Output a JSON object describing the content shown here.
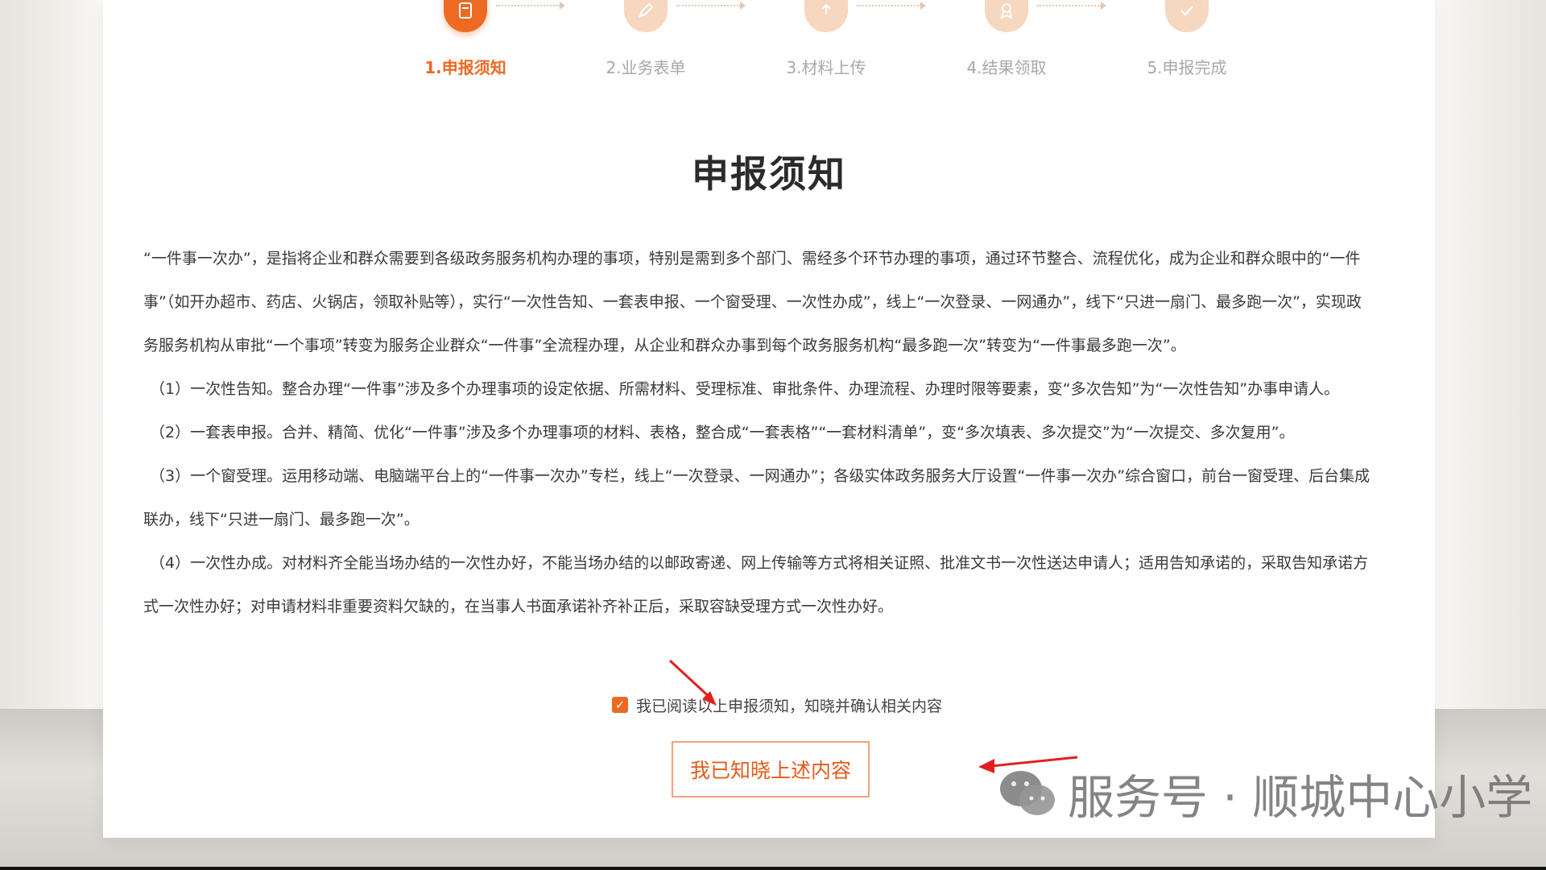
{
  "steps": [
    {
      "label": "1.申报须知",
      "icon": "document-icon",
      "active": true
    },
    {
      "label": "2.业务表单",
      "icon": "form-edit-icon",
      "active": false
    },
    {
      "label": "3.材料上传",
      "icon": "upload-icon",
      "active": false
    },
    {
      "label": "4.结果领取",
      "icon": "award-icon",
      "active": false
    },
    {
      "label": "5.申报完成",
      "icon": "check-icon",
      "active": false
    }
  ],
  "title": "申报须知",
  "paragraphs": [
    "“一件事一次办”，是指将企业和群众需要到各级政务服务机构办理的事项，特别是需到多个部门、需经多个环节办理的事项，通过环节整合、流程优化，成为企业和群众眼中的“一件事”（如开办超市、药店、火锅店，领取补贴等），实行“一次性告知、一套表申报、一个窗受理、一次性办成”，线上“一次登录、一网通办”，线下“只进一扇门、最多跑一次”，实现政务服务机构从审批“一个事项”转变为服务企业群众“一件事”全流程办理，从企业和群众办事到每个政务服务机构“最多跑一次”转变为“一件事最多跑一次”。",
    "（1）一次性告知。整合办理“一件事”涉及多个办理事项的设定依据、所需材料、受理标准、审批条件、办理流程、办理时限等要素，变“多次告知”为“一次性告知”办事申请人。",
    "（2）一套表申报。合并、精简、优化“一件事”涉及多个办理事项的材料、表格，整合成“一套表格”“一套材料清单”，变“多次填表、多次提交”为“一次提交、多次复用”。",
    "（3）一个窗受理。运用移动端、电脑端平台上的“一件事一次办”专栏，线上“一次登录、一网通办”；各级实体政务服务大厅设置“一件事一次办”综合窗口，前台一窗受理、后台集成联办，线下“只进一扇门、最多跑一次”。",
    "（4）一次性办成。对材料齐全能当场办结的一次性办好，不能当场办结的以邮政寄递、网上传输等方式将相关证照、批准文书一次性送达申请人；适用告知承诺的，采取告知承诺方式一次性办好；对申请材料非重要资料欠缺的，在当事人书面承诺补齐补正后，采取容缺受理方式一次性办好。"
  ],
  "agreement": {
    "checked": true,
    "text": "我已阅读以上申报须知，知晓并确认相关内容"
  },
  "confirm_button": "我已知晓上述内容",
  "watermark": "服务号 · 顺城中心小学",
  "colors": {
    "accent": "#ec6a22",
    "step_inactive": "#f6d7bf",
    "arrow": "#e02020"
  }
}
